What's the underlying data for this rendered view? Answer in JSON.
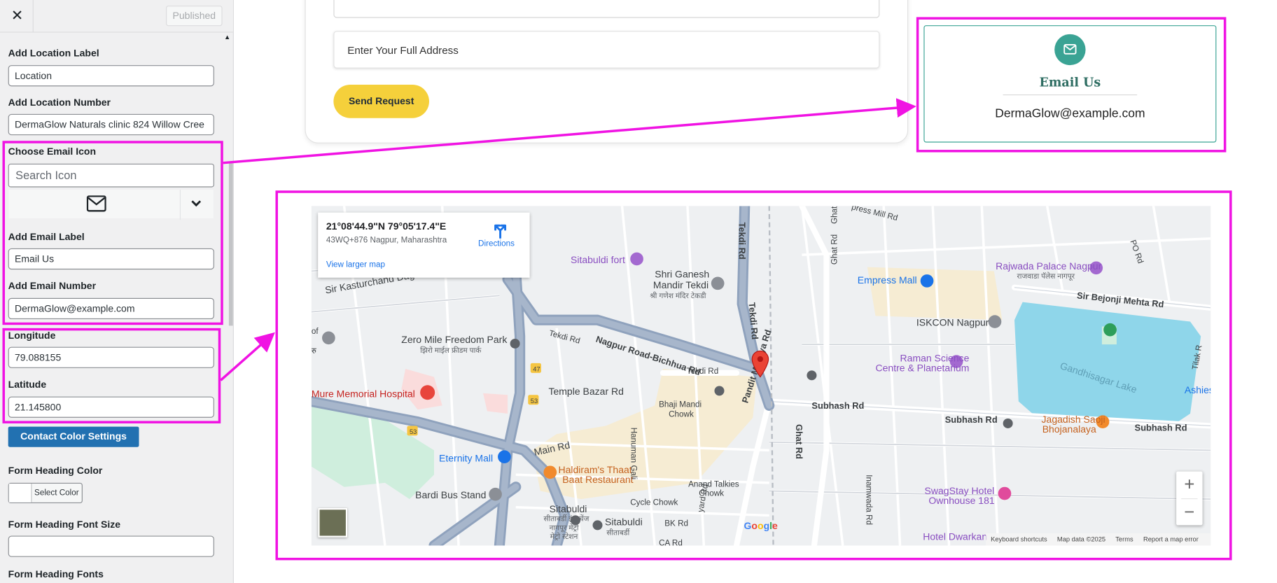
{
  "sidebar": {
    "published_label": "Published",
    "location_label_title": "Add Location Label",
    "location_label_value": "Location",
    "location_number_title": "Add Location Number",
    "location_number_value": "DermaGlow Naturals clinic  824 Willow Cree",
    "email_icon_title": "Choose Email Icon",
    "email_icon_placeholder": "Search Icon",
    "email_label_title": "Add Email Label",
    "email_label_value": "Email Us",
    "email_number_title": "Add Email Number",
    "email_number_value": "DermaGlow@example.com",
    "longitude_title": "Longitude",
    "longitude_value": "79.088155",
    "latitude_title": "Latitude",
    "latitude_value": "21.145800",
    "contact_color_button": "Contact Color Settings",
    "heading_color_title": "Form Heading Color",
    "select_color_label": "Select Color",
    "heading_font_size_title": "Form Heading Font Size",
    "heading_font_size_value": "",
    "heading_fonts_title": "Form Heading Fonts"
  },
  "form": {
    "address_placeholder": "Enter Your Full Address",
    "send_button": "Send Request"
  },
  "email_card": {
    "title": "Email Us",
    "value": "DermaGlow@example.com",
    "accent_color": "#3aa394"
  },
  "map": {
    "info": {
      "coords": "21°08'44.9\"N 79°05'17.4\"E",
      "address": "43WQ+876 Nagpur, Maharashtra",
      "directions": "Directions",
      "view_larger": "View larger map"
    },
    "labels": {
      "sitabuldi_fort": "Sitabuldi fort",
      "shri_ganesh_1": "Shri Ganesh",
      "shri_ganesh_2": "Mandir Tekdi",
      "shri_ganesh_3": "श्री गणेश मंदिर टेकडी",
      "tekdi_rd_vertical": "Tekdi Rd",
      "tekdi_rd_top": "Tekdi Rd",
      "tekdi_rd_small": "Tekdi Rd",
      "tekdi_rd_mid": "Tekdi Rd",
      "sir_kasturchand": "Sir Kasturchand Dag",
      "zero_mile_1": "Zero Mile Freedom Park",
      "zero_mile_2": "झिरो माईल फ्रीडम पार्क",
      "nagpur_road": "Nagpur Road-Bichhua Rd",
      "temple_bazar": "Temple Bazar Rd",
      "bhaji_mandi_1": "Bhaji Mandi",
      "bhaji_mandi_2": "Chowk",
      "mure_memorial": "Mure Memorial Hospital",
      "main_rd": "Main Rd",
      "eternity_mall": "Eternity Mall",
      "haldirams_1": "Haldiram's Thaat",
      "haldirams_2": "Baat Restaurant",
      "hanuman_gali": "Hanuman Gali",
      "bardi_bus": "Bardi Bus Stand",
      "sitabuldi_1": "Sitabuldi",
      "sitabuldi_2": "सीताबर्डी इंटरचेंज",
      "sitabuldi_3": "नागपूर मेट्रो",
      "sitabuldi_4": "मेट्रो स्टेशन",
      "sitabuldi_metro_1": "Sitabuldi",
      "sitabuldi_metro_2": "सीताबर्डी",
      "cycle_chowk": "Cycle Chowk",
      "anand_talkies_1": "Anand Talkies",
      "anand_talkies_2": "Chowk",
      "bk_rd": "BK Rd",
      "ca_rd": "CA Rd",
      "yard_rd": "yard Rd",
      "pandit_malviya": "Pandit Malviya Rd",
      "ghat_rd_1": "Ghat Rd",
      "ghat_rd_2": "Ghat Rd",
      "ghat_rd_3": "Ghat",
      "subhash_rd_1": "Subhash Rd",
      "subhash_rd_2": "Subhash Rd",
      "subhash_rd_3": "Subhash Rd",
      "empress_mall": "Empress Mall",
      "iskcon": "ISKCON Nagpur",
      "raman_1": "Raman Science",
      "raman_2": "Centre & Planetarium",
      "rajwada_1": "Rajwada Palace Nagpur",
      "rajwada_2": "राजवाडा पॅलेस नागपूर",
      "sir_bejonji": "Sir Bejonji Mehta Rd",
      "gandhisagar": "Gandhisagar Lake",
      "jagadish_1": "Jagadish Saoji",
      "jagadish_2": "Bhojanalaya",
      "swagstay_1": "SwagStay Hotel",
      "swagstay_2": "Ownhouse 181",
      "hotel_dwarkan": "Hotel Dwarkan",
      "inamwada": "Inamwada Rd",
      "tilak_r": "Tilak R",
      "ashies": "Ashies",
      "po_rd": "PO Rd",
      "press_mill": "press Mill Rd",
      "of_label": "of",
      "ru_label": "रु",
      "route_47": "47",
      "route_53a": "53",
      "route_53b": "53"
    },
    "attribution": {
      "shortcuts": "Keyboard shortcuts",
      "mapdata": "Map data ©2025",
      "terms": "Terms",
      "report": "Report a map error"
    },
    "google": "Google"
  },
  "colors": {
    "highlight": "#f013e3",
    "send_button": "#f5d03b",
    "primary_button": "#2271b1"
  },
  "icons": [
    "close-icon",
    "envelope-icon",
    "chevron-down-icon",
    "directions-icon",
    "map-pin-icon",
    "zoom-in-icon",
    "zoom-out-icon"
  ]
}
